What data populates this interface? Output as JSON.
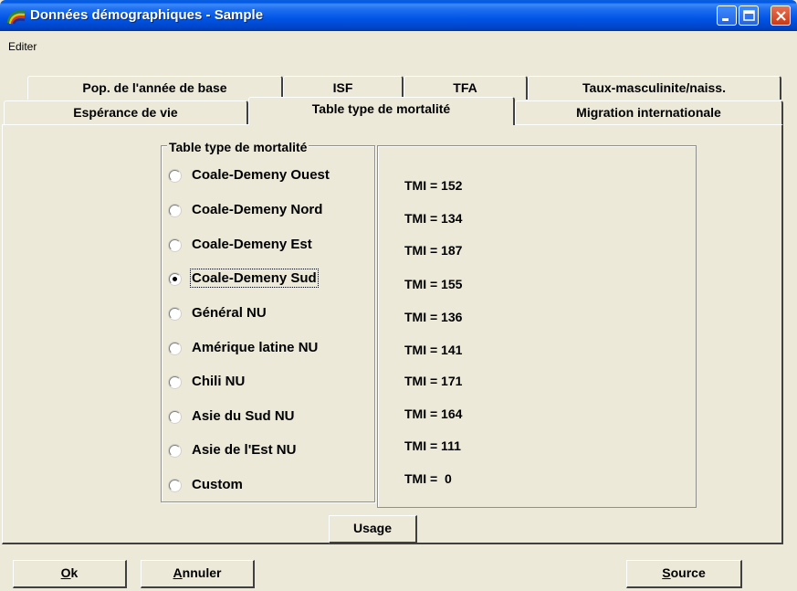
{
  "window": {
    "title": "Données démographiques - Sample",
    "app_icon": "rainbow-app-icon",
    "controls": {
      "minimize_icon": "minimize-icon",
      "maximize_icon": "maximize-icon",
      "close_icon": "close-icon"
    }
  },
  "menu": {
    "edit": "Editer"
  },
  "tabs": {
    "row1": [
      {
        "label": "Pop. de l'année de base"
      },
      {
        "label": "ISF"
      },
      {
        "label": "TFA"
      },
      {
        "label": "Taux-masculinite/naiss."
      }
    ],
    "row2": [
      {
        "label": "Espérance de vie"
      },
      {
        "label": "Table type de mortalité",
        "active": true
      },
      {
        "label": "Migration internationale"
      }
    ]
  },
  "group": {
    "title": "Table type de mortalité",
    "options": [
      {
        "label": "Coale-Demeny Ouest",
        "tmi": "TMI = 152",
        "selected": false
      },
      {
        "label": "Coale-Demeny Nord",
        "tmi": "TMI = 134",
        "selected": false
      },
      {
        "label": "Coale-Demeny Est",
        "tmi": "TMI = 187",
        "selected": false
      },
      {
        "label": "Coale-Demeny Sud",
        "tmi": "TMI = 155",
        "selected": true
      },
      {
        "label": "Général NU",
        "tmi": "TMI = 136",
        "selected": false
      },
      {
        "label": "Amérique latine NU",
        "tmi": "TMI = 141",
        "selected": false
      },
      {
        "label": "Chili NU",
        "tmi": "TMI = 171",
        "selected": false
      },
      {
        "label": "Asie du Sud NU",
        "tmi": "TMI = 164",
        "selected": false
      },
      {
        "label": "Asie de l'Est NU",
        "tmi": "TMI = 111",
        "selected": false
      },
      {
        "label": "Custom",
        "tmi": "TMI =  0",
        "selected": false
      }
    ]
  },
  "buttons": {
    "usage": "Usage",
    "ok": {
      "mnemonic": "O",
      "rest": "k"
    },
    "cancel": {
      "mnemonic": "A",
      "rest": "nnuler"
    },
    "source": {
      "mnemonic": "S",
      "rest": "ource"
    }
  },
  "colors": {
    "titlebar": "#0055e5",
    "face": "#ece9d8",
    "close": "#c93a17"
  }
}
